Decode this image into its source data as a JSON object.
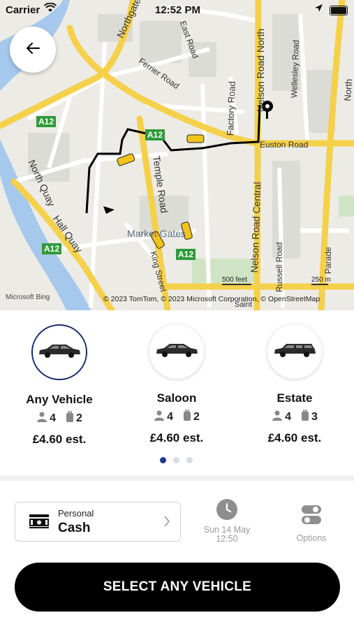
{
  "status_bar": {
    "carrier": "Carrier",
    "time": "12:52 PM"
  },
  "map": {
    "streets": [
      "Northgate",
      "East Road",
      "Ferrier Road",
      "Factory Road",
      "Nelson Road North",
      "Wellesley Road",
      "North Drive",
      "Euston Road",
      "Temple Road",
      "North Quay",
      "Hall Quay",
      "King Street",
      "Nelson Road Central",
      "Russell Road",
      "Parade",
      "Saint"
    ],
    "road_badges": [
      "A12",
      "A12",
      "A12",
      "A12"
    ],
    "place": "Market Gates",
    "scale_feet": "500 feet",
    "scale_m": "250 m",
    "provider": "Microsoft Bing",
    "copyright": "© 2023 TomTom, © 2023 Microsoft Corporation, © OpenStreetMap"
  },
  "vehicles": [
    {
      "name": "Any Vehicle",
      "passengers": "4",
      "luggage": "2",
      "price": "£4.60 est.",
      "selected": true
    },
    {
      "name": "Saloon",
      "passengers": "4",
      "luggage": "2",
      "price": "£4.60 est.",
      "selected": false
    },
    {
      "name": "Estate",
      "passengers": "4",
      "luggage": "3",
      "price": "£4.60 est.",
      "selected": false
    }
  ],
  "pager": {
    "pages": 3,
    "active": 0
  },
  "payment": {
    "type": "Personal",
    "method": "Cash"
  },
  "schedule": {
    "date": "Sun 14 May",
    "time": "12:50"
  },
  "options_label": "Options",
  "cta_label": "SELECT ANY VEHICLE",
  "colors": {
    "selected_ring": "#1b2a6b",
    "dot_active": "#1d3a8a",
    "road_major": "#f5d04a",
    "route": "#000000"
  }
}
